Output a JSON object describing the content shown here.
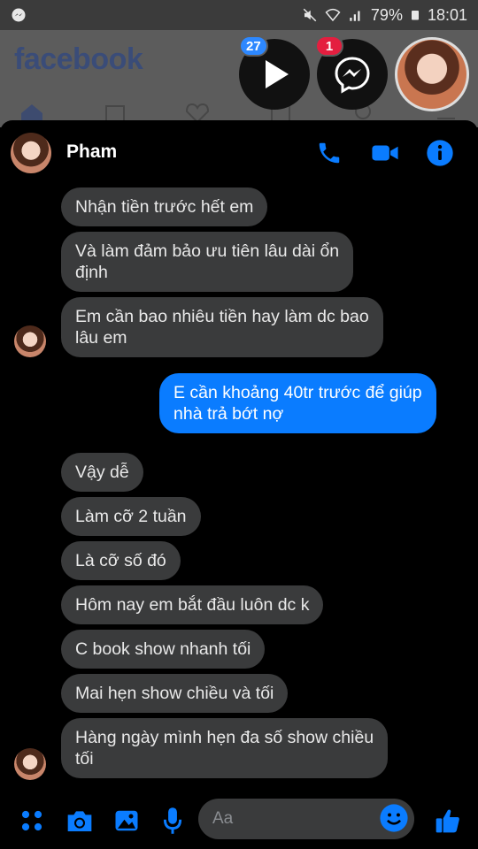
{
  "statusbar": {
    "battery": "79%",
    "time": "18:01"
  },
  "facebook": {
    "logo": "facebook"
  },
  "chatheads": [
    {
      "badge": "27",
      "badge_color": "#2d88ff"
    },
    {
      "badge": "1",
      "badge_color": "#e41e3f"
    }
  ],
  "chat": {
    "name": "Pham",
    "accent": "#0a7cff",
    "messages": [
      {
        "from": "them",
        "lines": [
          "Nhận tiền trước hết em"
        ]
      },
      {
        "from": "them",
        "lines": [
          "Và làm đảm bảo ưu tiên lâu dài ổn",
          "định"
        ]
      },
      {
        "from": "them",
        "lines": [
          "Em cần bao nhiêu tiền hay làm dc bao",
          "lâu em"
        ]
      },
      {
        "from": "me",
        "lines": [
          "E cần khoảng 40tr trước để giúp",
          "nhà trả bớt nợ"
        ]
      },
      {
        "from": "them",
        "lines": [
          "Vậy dễ"
        ]
      },
      {
        "from": "them",
        "lines": [
          "Làm cỡ 2 tuần"
        ]
      },
      {
        "from": "them",
        "lines": [
          "Là cỡ số đó"
        ]
      },
      {
        "from": "them",
        "lines": [
          "Hôm nay em bắt đầu luôn dc k"
        ]
      },
      {
        "from": "them",
        "lines": [
          "C book show nhanh tối"
        ]
      },
      {
        "from": "them",
        "lines": [
          "Mai hẹn show chiều và tối"
        ]
      },
      {
        "from": "them",
        "lines": [
          "Hàng ngày mình hẹn đa số show chiều",
          "tối"
        ]
      }
    ]
  },
  "composer": {
    "placeholder": "Aa"
  }
}
